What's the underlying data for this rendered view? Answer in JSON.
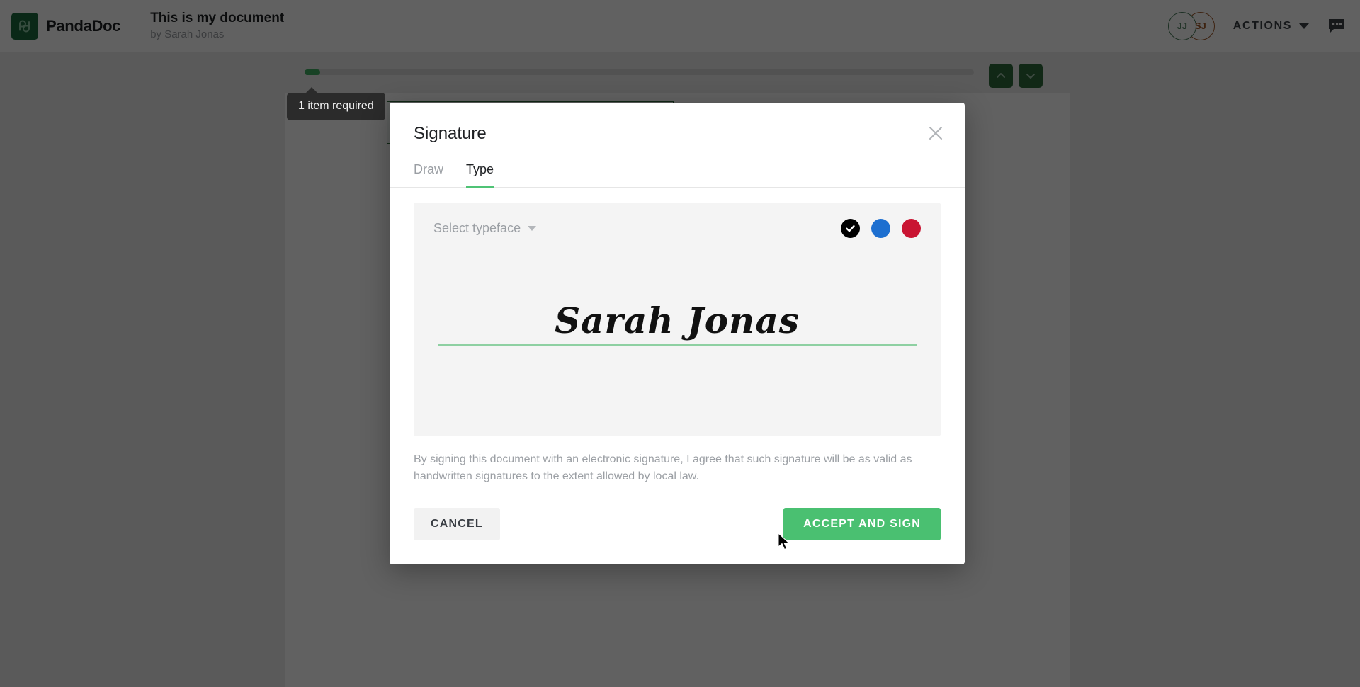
{
  "app": {
    "brand_name": "PandaDoc",
    "logo_monogram": "pd",
    "brand_green": "#1c6b3e"
  },
  "header": {
    "document_title": "This is my document",
    "document_author": "by Sarah Jonas",
    "avatars": [
      {
        "initials": "JJ",
        "color": "#4b7d5c"
      },
      {
        "initials": "SJ",
        "color": "#a05a2c"
      }
    ],
    "actions_label": "ACTIONS",
    "comments_icon": "comment-bubble-icon"
  },
  "toolbar": {
    "progress_percent": 2,
    "prev_page_icon": "chevron-up-icon",
    "next_page_icon": "chevron-down-icon"
  },
  "tooltip": {
    "text": "1 item required"
  },
  "modal": {
    "title": "Signature",
    "close_icon": "close-icon",
    "tabs": [
      {
        "label": "Draw",
        "active": false
      },
      {
        "label": "Type",
        "active": true
      }
    ],
    "typeface_placeholder": "Select typeface",
    "colors": [
      {
        "name": "black",
        "hex": "#000000",
        "selected": true
      },
      {
        "name": "blue",
        "hex": "#1d6fd0",
        "selected": false
      },
      {
        "name": "red",
        "hex": "#c91432",
        "selected": false
      }
    ],
    "signature_value": "Sarah Jonas",
    "signature_rule_color": "#8ed0a2",
    "disclaimer": "By signing this document with an electronic signature, I agree that such signature will be as valid as handwritten signatures to the extent allowed by local law.",
    "cancel_label": "CANCEL",
    "accept_label": "ACCEPT AND SIGN",
    "accept_color": "#4ac071"
  }
}
